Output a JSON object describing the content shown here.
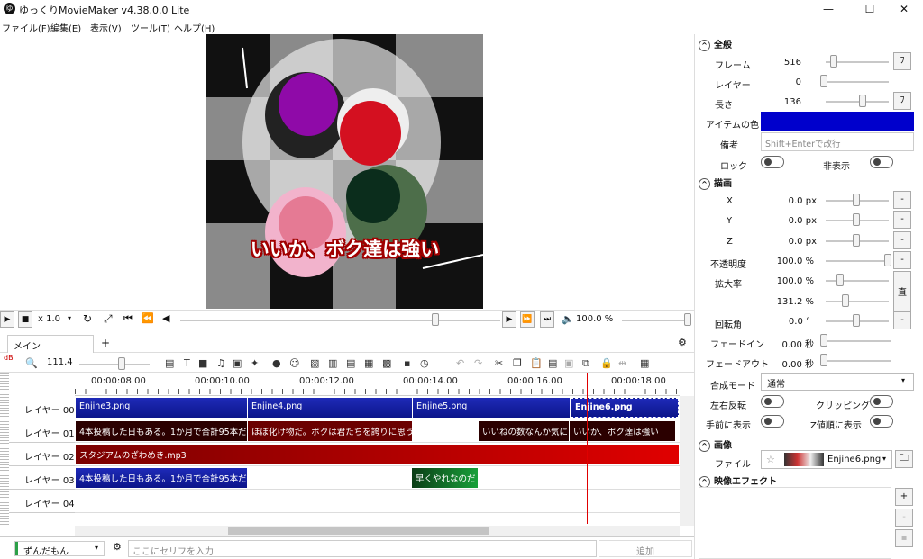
{
  "app": {
    "title": "ゆっくりMovieMaker v4.38.0.0 Lite",
    "icon": "ゆ"
  },
  "window_controls": {
    "minimize": "—",
    "maximize": "☐",
    "close": "✕"
  },
  "menu": [
    "ファイル(F)",
    "編集(E)",
    "表示(V)",
    "ツール(T)",
    "ヘルプ(H)"
  ],
  "preview": {
    "caption": "いいか、ボク達は強い"
  },
  "playback": {
    "speed": "x 1.0",
    "volume": "100.0 %"
  },
  "tabs": {
    "main": "メイン",
    "add": "+"
  },
  "timeline": {
    "zoom": "111.4",
    "ruler": [
      "00:00:08.00",
      "00:00:10.00",
      "00:00:12.00",
      "00:00:14.00",
      "00:00:16.00",
      "00:00:18.00"
    ],
    "layers": [
      "レイヤー 00",
      "レイヤー 01",
      "レイヤー 02",
      "レイヤー 03",
      "レイヤー 04"
    ],
    "clips": {
      "l0": [
        "Enjine3.png",
        "Enjine4.png",
        "Enjine5.png",
        "Enjine6.png"
      ],
      "l1": [
        "4本投稿した日もある。1か月で合計95本だ",
        "ほぼ化け物だ。ボクは君たちを誇りに思う。",
        "いいねの数なんか気に",
        "いいか、ボク達は強い"
      ],
      "l2": [
        "スタジアムのざわめき.mp3"
      ],
      "l3": [
        "4本投稿した日もある。1か月で合計95本だ",
        "早くやれなのだ"
      ]
    }
  },
  "bottom": {
    "speaker": "ずんだもん",
    "placeholder": "ここにセリフを入力",
    "add": "追加"
  },
  "props": {
    "sections": {
      "general": "全般",
      "draw": "描画",
      "image": "画像",
      "effects": "映像エフェクト"
    },
    "frame_label": "フレーム",
    "frame_value": "516",
    "layer_label": "レイヤー",
    "layer_value": "0",
    "length_label": "長さ",
    "length_value": "136",
    "color_label": "アイテムの色",
    "color_value": "#0000cc",
    "note_label": "備考",
    "note_placeholder": "Shift+Enterで改行",
    "lock_label": "ロック",
    "hide_label": "非表示",
    "x_label": "X",
    "x_value": "0.0 px",
    "y_label": "Y",
    "y_value": "0.0 px",
    "z_label": "Z",
    "z_value": "0.0 px",
    "opacity_label": "不透明度",
    "opacity_value": "100.0 %",
    "scale_label": "拡大率",
    "scale_value": "100.0 %",
    "scale_value2": "131.2 %",
    "scale_btn": "直",
    "rotation_label": "回転角",
    "rotation_value": "0.0 °",
    "fadein_label": "フェードイン",
    "fadein_value": "0.00 秒",
    "fadeout_label": "フェードアウト",
    "fadeout_value": "0.00 秒",
    "blend_label": "合成モード",
    "blend_value": "通常",
    "flip_label": "左右反転",
    "clip_label": "クリッピング",
    "front_label": "手前に表示",
    "zorder_label": "Z値順に表示",
    "file_label": "ファイル",
    "file_value": "Enjine6.png",
    "f_btn": "ﾌ",
    "minus": "-",
    "plus": "+"
  }
}
